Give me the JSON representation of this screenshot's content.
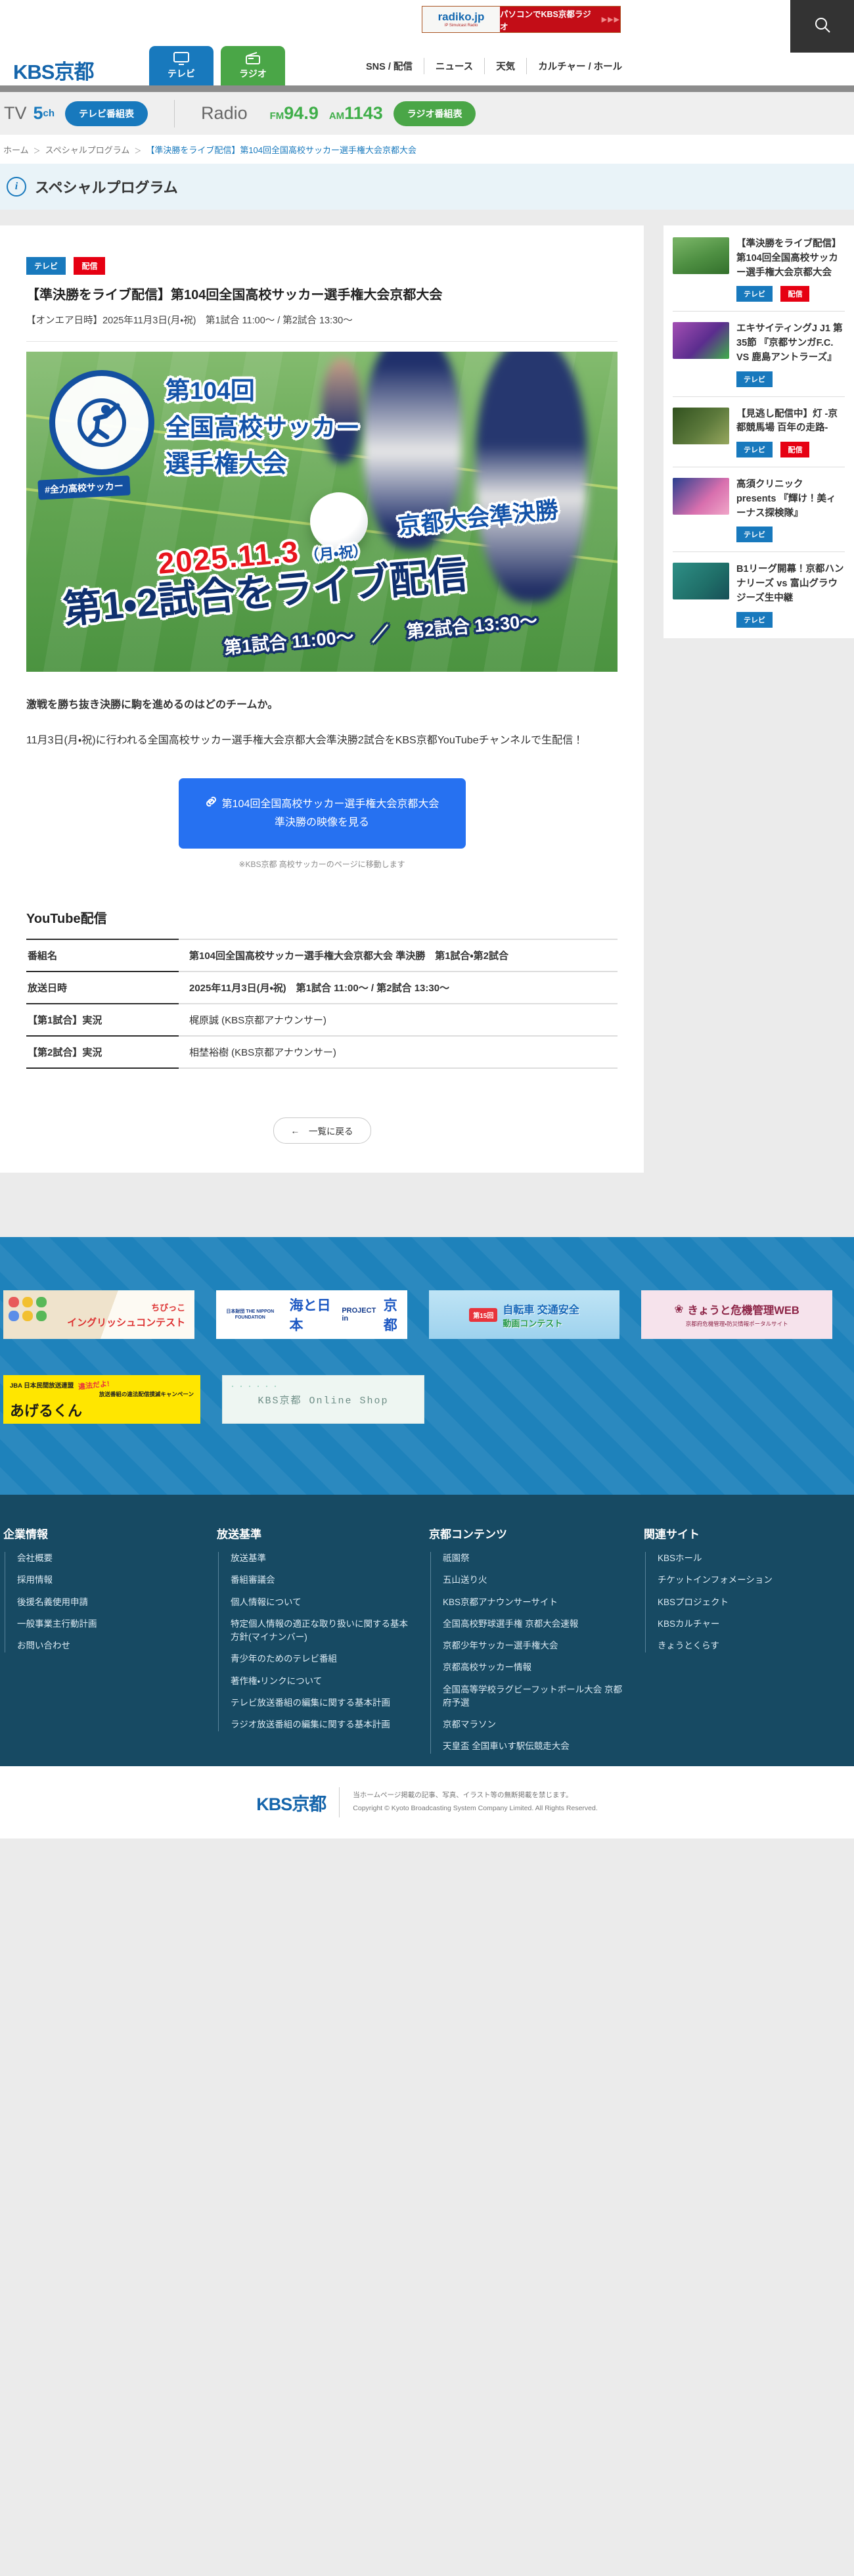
{
  "header": {
    "logo": "KBS京都",
    "radiko": {
      "brand": "radiko.jp",
      "sub": "IP Simulcast Radio",
      "text": "パソコンでKBS京都ラジオ",
      "arrows": "▶▶▶"
    },
    "tabs": {
      "tv": "テレビ",
      "radio": "ラジオ"
    },
    "nav": [
      "SNS / 配信",
      "ニュース",
      "天気",
      "カルチャー / ホール"
    ],
    "broadcast": {
      "tv_label": "TV",
      "tv_ch": "5",
      "tv_ch_unit": "ch",
      "tv_btn": "テレビ番組表",
      "radio_label": "Radio",
      "fm_prefix": "FM",
      "fm": "94.9",
      "am_prefix": "AM",
      "am": "1143",
      "radio_btn": "ラジオ番組表"
    }
  },
  "breadcrumb": {
    "home": "ホーム",
    "section": "スペシャルプログラム",
    "current": "【準決勝をライブ配信】第104回全国高校サッカー選手権大会京都大会",
    "sep": "＞"
  },
  "page": {
    "title": "スペシャルプログラム"
  },
  "article": {
    "tag1": "テレビ",
    "tag2": "配信",
    "title": "【準決勝をライブ配信】第104回全国高校サッカー選手権大会京都大会",
    "onair": "【オンエア日時】2025年11月3日(月・祝)　第1試合 11:00〜 / 第2試合 13:30〜",
    "hero": {
      "logo_line1": "第104回",
      "logo_line2": "全国高校サッカー",
      "logo_line3": "選手権大会",
      "hashtag": "#全力高校サッカー",
      "round": "京都大会準決勝",
      "date": "2025.11.3",
      "date_note": "（月・祝）",
      "headline": "第1・2試合をライブ配信",
      "times": "第1試合 11:00〜　／　第2試合 13:30〜"
    },
    "p1": "激戦を勝ち抜き決勝に駒を進めるのはどのチームか。",
    "p2": "11月3日(月・祝)に行われる全国高校サッカー選手権大会京都大会準決勝2試合をKBS京都YouTubeチャンネルで生配信！",
    "cta": {
      "line1": "第104回全国高校サッカー選手権大会京都大会",
      "line2": "準決勝の映像を見る"
    },
    "cta_note": "※KBS京都 高校サッカーのページに移動します",
    "section_title": "YouTube配信",
    "table": [
      {
        "label": "番組名",
        "value": "第104回全国高校サッカー選手権大会京都大会 準決勝　第1試合・第2試合",
        "style": "font-weight:700"
      },
      {
        "label": "放送日時",
        "value": "2025年11月3日(月・祝)　第1試合 11:00〜 / 第2試合 13:30〜",
        "style": "font-weight:700"
      },
      {
        "label": "【第1試合】実況",
        "value": "梶原誠 (KBS京都アナウンサー)",
        "style": "font-weight:400"
      },
      {
        "label": "【第2試合】実況",
        "value": "相埜裕樹 (KBS京都アナウンサー)",
        "style": "font-weight:400"
      }
    ],
    "back_arrow": "←",
    "back_button": "一覧に戻る"
  },
  "sidebar": {
    "items": [
      {
        "title": "【準決勝をライブ配信】第104回全国高校サッカー選手権大会京都大会",
        "tag1": "テレビ",
        "tag2": "配信"
      },
      {
        "title": "エキサイティングJ J1 第35節 『京都サンガF.C. VS 鹿島アントラーズ』",
        "tag1": "テレビ",
        "tag2": ""
      },
      {
        "title": "【見逃し配信中】灯 -京都競馬場 百年の走路-",
        "tag1": "テレビ",
        "tag2": "配信"
      },
      {
        "title": "高須クリニック presents 『輝け！美ィーナス探検隊』",
        "tag1": "テレビ",
        "tag2": ""
      },
      {
        "title": "B1リーグ開幕！京都ハンナリーズ vs 富山グラウジーズ生中継",
        "tag1": "テレビ",
        "tag2": ""
      }
    ]
  },
  "banners": {
    "chibikko": {
      "line1": "ちびっこ",
      "line2": "イングリッシュコンテスト"
    },
    "umi": {
      "logo": "日本財団 THE NIPPON FOUNDATION",
      "big": "海と日本",
      "mid": "PROJECT in",
      "big2": "京都"
    },
    "bike": {
      "badge": "第15回",
      "line1": "自転車 交通安全",
      "line2": "動画コンテスト"
    },
    "kiki": {
      "flower": "❀",
      "title": "きょうと危機管理WEB",
      "sub": "京都府危機管理・防災情報ポータルサイト"
    },
    "ageru": {
      "org": "JBA 日本民間放送連盟",
      "warn": "違法だよ!",
      "sub": "放送番組の違法配信撲滅キャンペーン",
      "name": "あげるくん"
    },
    "shop": {
      "dots": "・・・・・・",
      "label": "KBS京都 Online Shop"
    }
  },
  "footer": {
    "columns": [
      {
        "title": "企業情報",
        "items": [
          "会社概要",
          "採用情報",
          "後援名義使用申請",
          "一般事業主行動計画",
          "お問い合わせ"
        ]
      },
      {
        "title": "放送基準",
        "items": [
          "放送基準",
          "番組審議会",
          "個人情報について",
          "特定個人情報の適正な取り扱いに関する基本方針(マイナンバー)",
          "青少年のためのテレビ番組",
          "著作権・リンクについて",
          "テレビ放送番組の編集に関する基本計画",
          "ラジオ放送番組の編集に関する基本計画"
        ]
      },
      {
        "title": "京都コンテンツ",
        "items": [
          "祇園祭",
          "五山送り火",
          "KBS京都アナウンサーサイト",
          "全国高校野球選手権 京都大会速報",
          "京都少年サッカー選手権大会",
          "京都高校サッカー情報",
          "全国高等学校ラグビーフットボール大会 京都府予選",
          "京都マラソン",
          "天皇盃 全国車いす駅伝競走大会"
        ]
      },
      {
        "title": "関連サイト",
        "items": [
          "KBSホール",
          "チケットインフォメーション",
          "KBSプロジェクト",
          "KBSカルチャー",
          "きょうとくらす"
        ]
      }
    ]
  },
  "bottom": {
    "logo": "KBS京都",
    "line1": "当ホームページ掲載の記事、写真、イラスト等の無断掲載を禁じます。",
    "line2": "Copyright © Kyoto Broadcasting System Company Limited. All Rights Reserved."
  },
  "colors": {
    "brand_blue": "#1879bd",
    "brand_green": "#4aa647",
    "tag_red": "#e60012",
    "cta_blue": "#2671f1",
    "stripe_blue": "#1e82bb",
    "footer_navy": "#174a63"
  }
}
